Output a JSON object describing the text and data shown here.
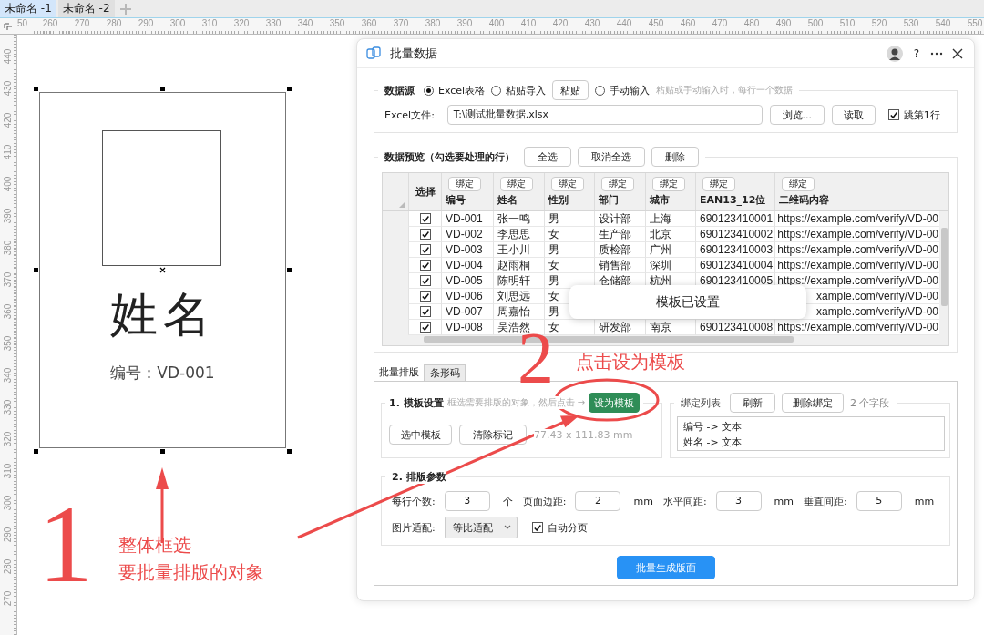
{
  "doc_tabs": [
    {
      "label": "未命名 -1",
      "selected": true
    },
    {
      "label": "未命名 -2",
      "selected": false
    }
  ],
  "ruler": {
    "horizontal": [
      "50",
      "260",
      "270",
      "280",
      "290",
      "300",
      "310",
      "320",
      "330",
      "340",
      "350",
      "360",
      "370",
      "380",
      "390",
      "400",
      "410",
      "420",
      "430",
      "440",
      "450",
      "460",
      "470",
      "480",
      "490",
      "500",
      "510",
      "520",
      "530",
      "540",
      "550"
    ],
    "vertical": [
      "440",
      "430",
      "420",
      "410",
      "400",
      "390",
      "380",
      "370",
      "360",
      "350",
      "340",
      "330",
      "320",
      "310",
      "300",
      "290",
      "280",
      "270"
    ]
  },
  "card": {
    "name_text": "姓名",
    "id_line": "编号：VD-001"
  },
  "dialog": {
    "title": "批量数据",
    "help_button": "?",
    "source": {
      "label": "数据源",
      "options": [
        {
          "label": "Excel表格",
          "selected": true
        },
        {
          "label": "粘贴导入",
          "selected": false,
          "button": "粘贴"
        },
        {
          "label": "手动输入",
          "selected": false
        }
      ],
      "hint": "粘贴或手动输入时，每行一个数据",
      "file_label": "Excel文件:",
      "file_value": "T:\\测试批量数据.xlsx",
      "browse_button": "浏览...",
      "read_button": "读取",
      "skip_first": {
        "label": "跳第1行",
        "checked": true
      }
    },
    "preview": {
      "label": "数据预览（勾选要处理的行）",
      "buttons": [
        "全选",
        "取消全选",
        "删除"
      ],
      "select_header": "选择",
      "columns": [
        {
          "bind": "绑定",
          "name": "编号"
        },
        {
          "bind": "绑定",
          "name": "姓名"
        },
        {
          "bind": "绑定",
          "name": "性别"
        },
        {
          "bind": "绑定",
          "name": "部门"
        },
        {
          "bind": "绑定",
          "name": "城市"
        },
        {
          "bind": "绑定",
          "name": "EAN13_12位"
        },
        {
          "bind": "绑定",
          "name": "二维码内容"
        }
      ],
      "rows": [
        {
          "checked": true,
          "cells": [
            "VD-001",
            "张一鸣",
            "男",
            "设计部",
            "上海",
            "690123410001",
            "https://example.com/verify/VD-00"
          ]
        },
        {
          "checked": true,
          "cells": [
            "VD-002",
            "李思思",
            "女",
            "生产部",
            "北京",
            "690123410002",
            "https://example.com/verify/VD-00"
          ]
        },
        {
          "checked": true,
          "cells": [
            "VD-003",
            "王小川",
            "男",
            "质检部",
            "广州",
            "690123410003",
            "https://example.com/verify/VD-00"
          ]
        },
        {
          "checked": true,
          "cells": [
            "VD-004",
            "赵雨桐",
            "女",
            "销售部",
            "深圳",
            "690123410004",
            "https://example.com/verify/VD-00"
          ]
        },
        {
          "checked": true,
          "cells": [
            "VD-005",
            "陈明轩",
            "男",
            "仓储部",
            "杭州",
            "690123410005",
            "https://example.com/verify/VD-00"
          ]
        },
        {
          "checked": true,
          "cells": [
            "VD-006",
            "刘思远",
            "女",
            null,
            null,
            null,
            "xample.com/verify/VD-00"
          ]
        },
        {
          "checked": true,
          "cells": [
            "VD-007",
            "周嘉怡",
            "男",
            null,
            null,
            null,
            "xample.com/verify/VD-00"
          ]
        },
        {
          "checked": true,
          "cells": [
            "VD-008",
            "吴浩然",
            "女",
            "研发部",
            "南京",
            "690123410008",
            "https://example.com/verify/VD-00"
          ]
        }
      ]
    },
    "toast": "模板已设置",
    "tabs": [
      {
        "label": "批量排版",
        "selected": true
      },
      {
        "label": "条形码",
        "selected": false
      }
    ],
    "template": {
      "label": "1. 模板设置",
      "hint": "框选需要排版的对象，然后点击 →",
      "set_button": "设为模板",
      "select_button": "选中模板",
      "clear_button": "清除标记",
      "size": "77.43 x 111.83 mm"
    },
    "binding": {
      "label": "绑定列表",
      "refresh_button": "刷新",
      "delete_button": "删除绑定",
      "count": "2 个字段",
      "items": [
        "编号 -> 文本",
        "姓名 -> 文本"
      ]
    },
    "params": {
      "label": "2. 排版参数",
      "fields": [
        {
          "label": "每行个数:",
          "value": "3",
          "unit": "个"
        },
        {
          "label": "页面边距:",
          "value": "2",
          "unit": "mm"
        },
        {
          "label": "水平间距:",
          "value": "3",
          "unit": "mm"
        },
        {
          "label": "垂直间距:",
          "value": "5",
          "unit": "mm"
        }
      ],
      "fit": {
        "label": "图片适配:",
        "value": "等比适配"
      },
      "auto_page": {
        "label": "自动分页",
        "checked": true
      }
    },
    "generate_button": "批量生成版面"
  },
  "annotations": {
    "step1": {
      "number": "1",
      "lines": [
        "整体框选",
        "要批量排版的对象"
      ]
    },
    "step2": {
      "number": "2",
      "caption": "点击设为模板"
    }
  }
}
